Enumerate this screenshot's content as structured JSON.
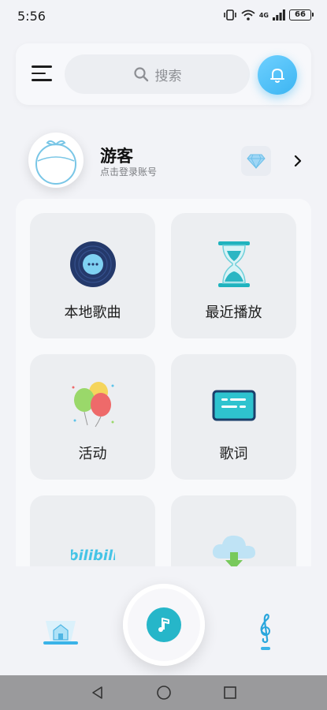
{
  "status_bar": {
    "time": "5:56",
    "network": "4G",
    "battery": "66"
  },
  "header": {
    "search_placeholder": "搜索",
    "accent_color": "#3cb5f2"
  },
  "profile": {
    "name": "游客",
    "hint": "点击登录账号"
  },
  "tiles": [
    {
      "label": "本地歌曲",
      "icon": "vinyl-record-icon"
    },
    {
      "label": "最近播放",
      "icon": "hourglass-icon"
    },
    {
      "label": "活动",
      "icon": "balloons-icon"
    },
    {
      "label": "歌词",
      "icon": "lyrics-card-icon"
    },
    {
      "label": "",
      "icon": "bilibili-icon"
    },
    {
      "label": "",
      "icon": "cloud-download-icon"
    }
  ],
  "bottom_nav": {
    "items": [
      {
        "name": "home",
        "icon": "home-icon",
        "active": true
      },
      {
        "name": "player",
        "icon": "music-note-icon"
      },
      {
        "name": "music",
        "icon": "treble-clef-icon"
      }
    ]
  },
  "system_nav": [
    "back",
    "home",
    "recents"
  ]
}
